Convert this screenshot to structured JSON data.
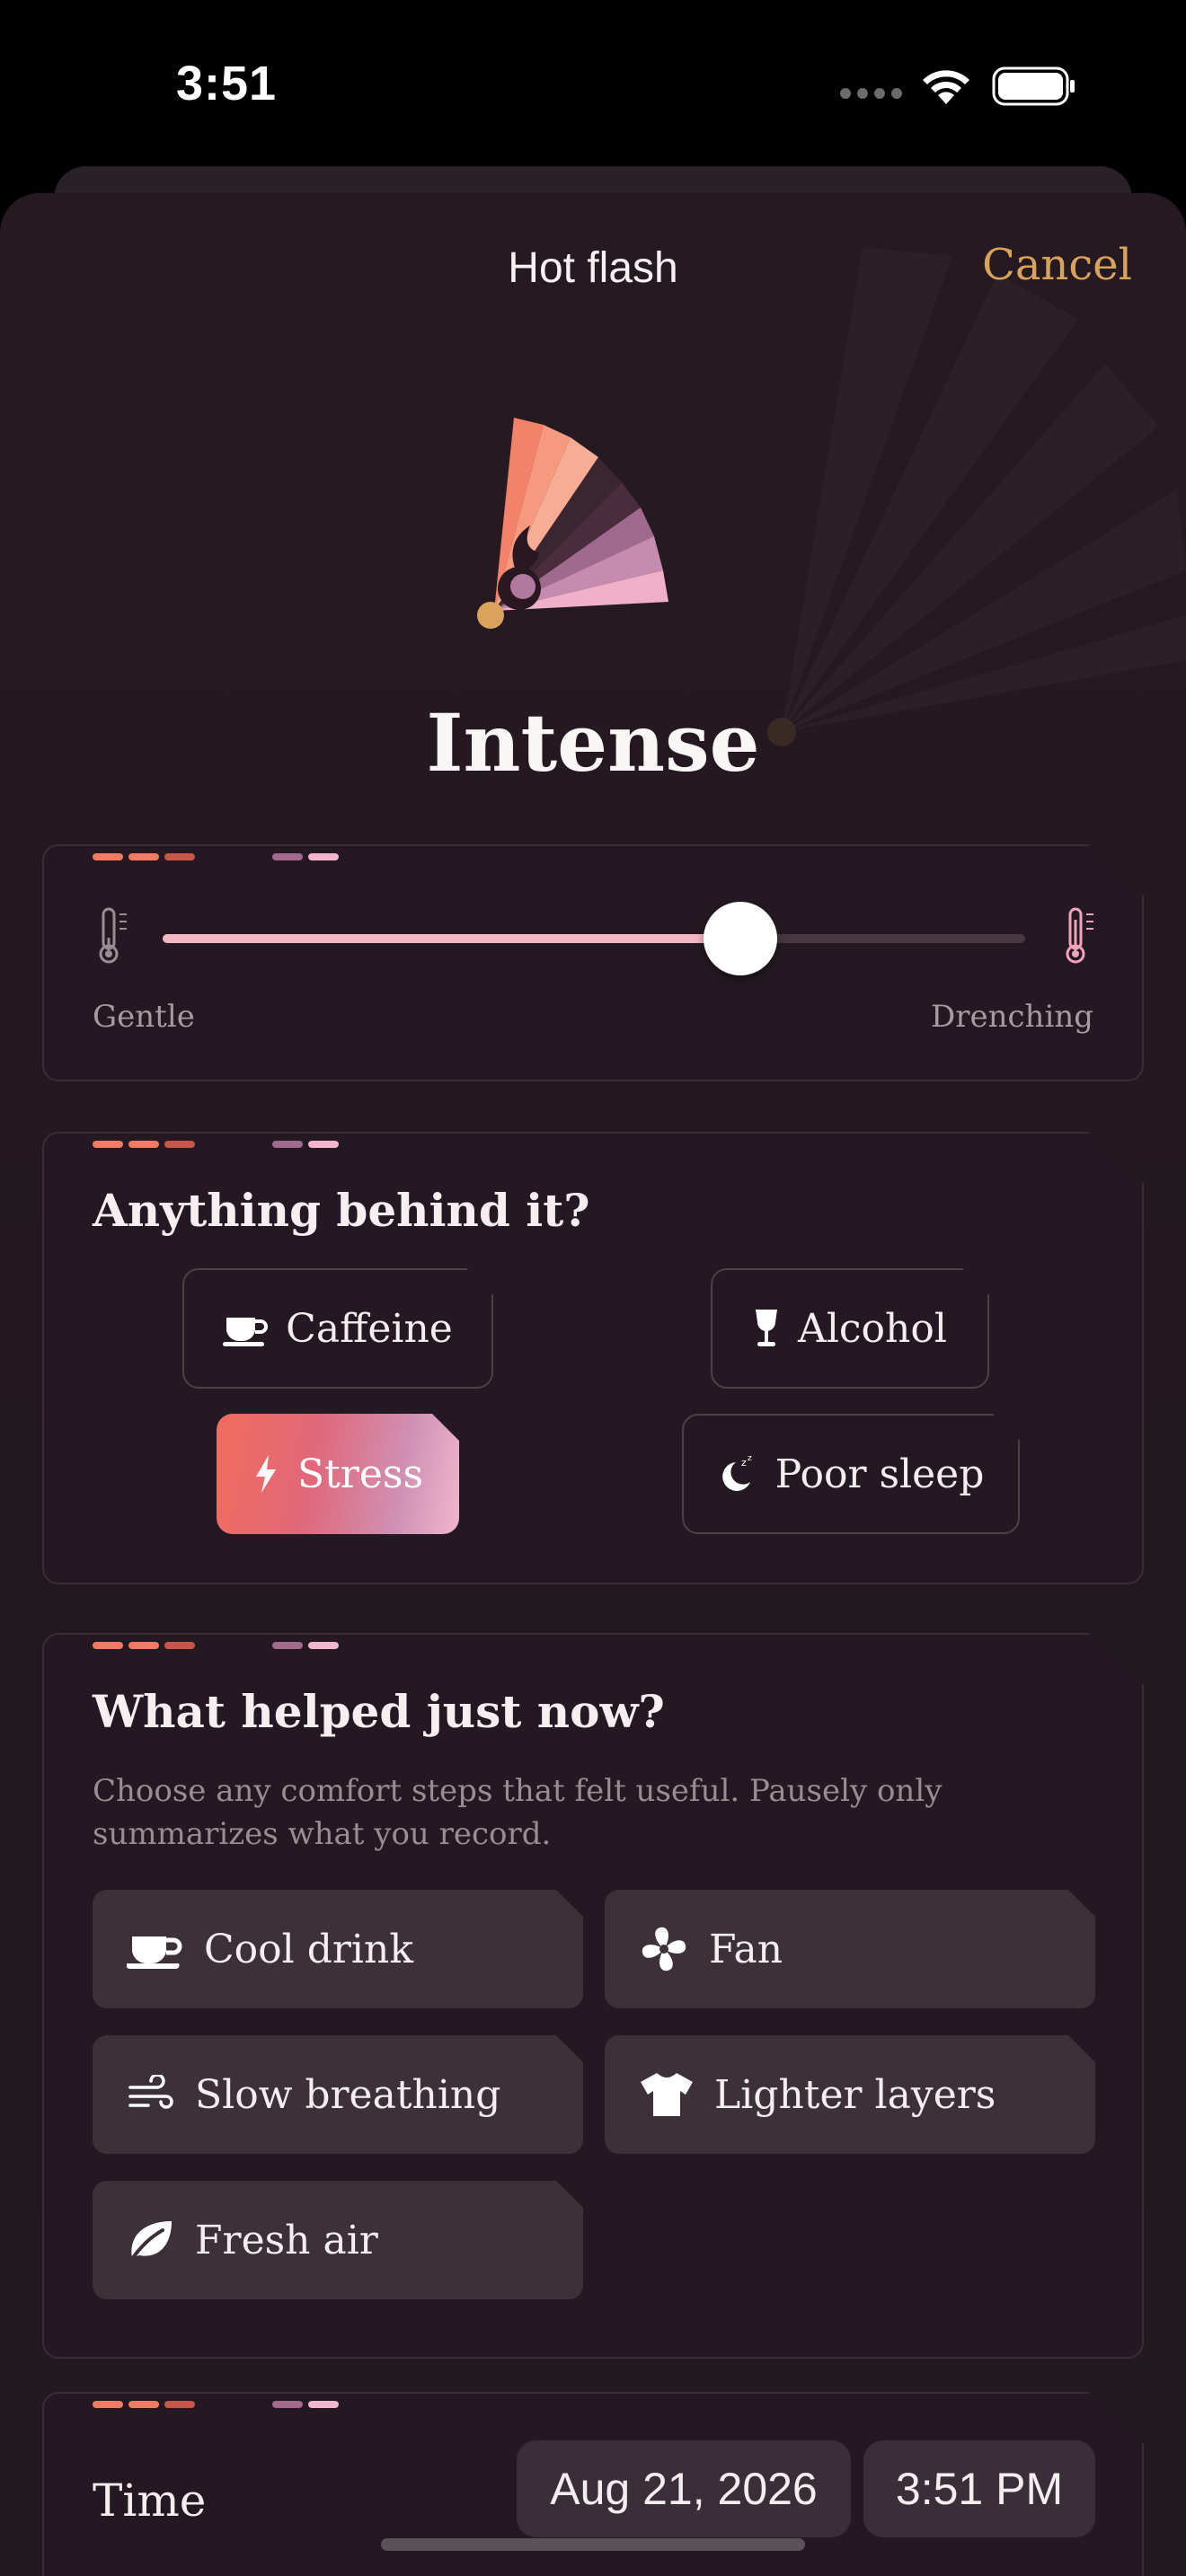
{
  "status_bar": {
    "time": "3:51"
  },
  "nav": {
    "title": "Hot flash",
    "cancel_label": "Cancel"
  },
  "intensity": {
    "label": "Intense",
    "value": 0.67,
    "min_label": "Gentle",
    "max_label": "Drenching"
  },
  "triggers": {
    "title": "Anything behind it?",
    "options": [
      {
        "label": "Caffeine",
        "icon": "coffee-cup-icon",
        "selected": false
      },
      {
        "label": "Alcohol",
        "icon": "wine-glass-icon",
        "selected": false
      },
      {
        "label": "Stress",
        "icon": "lightning-icon",
        "selected": true
      },
      {
        "label": "Poor sleep",
        "icon": "moon-zzz-icon",
        "selected": false
      }
    ]
  },
  "helped": {
    "title": "What helped just now?",
    "subtitle": "Choose any comfort steps that felt useful. Pausely only summarizes what you record.",
    "options": [
      {
        "label": "Cool drink",
        "icon": "coffee-cup-icon"
      },
      {
        "label": "Fan",
        "icon": "fan-icon"
      },
      {
        "label": "Slow breathing",
        "icon": "wind-icon"
      },
      {
        "label": "Lighter layers",
        "icon": "tshirt-icon"
      },
      {
        "label": "Fresh air",
        "icon": "leaf-icon"
      }
    ]
  },
  "time": {
    "label": "Time",
    "date": "Aug 21, 2026",
    "clock": "3:51 PM"
  },
  "colors": {
    "accent": "#d9a35c",
    "background": "#241922",
    "stress_gradient_start": "#f06c5c",
    "stress_gradient_end": "#f0b6cc",
    "slider_fill": "#f4b8c4"
  }
}
